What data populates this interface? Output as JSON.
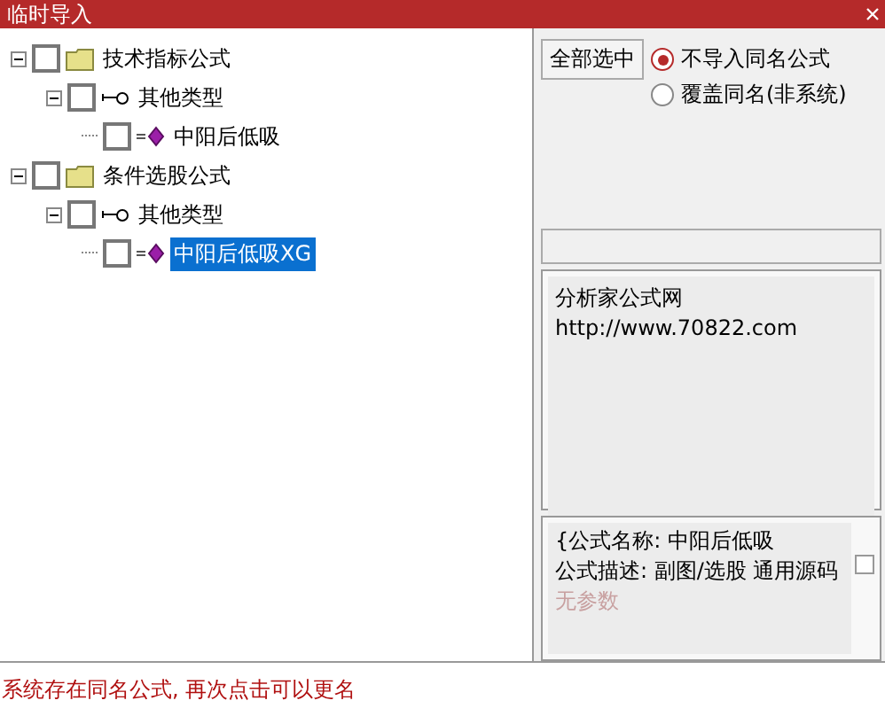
{
  "window": {
    "title": "临时导入"
  },
  "tree": [
    {
      "label": "技术指标公式",
      "kind": "folder",
      "checked": false,
      "expanded": true,
      "selected": false,
      "children": [
        {
          "label": "其他类型",
          "kind": "type",
          "checked": false,
          "expanded": true,
          "selected": false,
          "children": [
            {
              "label": "中阳后低吸",
              "kind": "formula",
              "checked": false,
              "selected": false
            }
          ]
        }
      ]
    },
    {
      "label": "条件选股公式",
      "kind": "folder",
      "checked": false,
      "expanded": true,
      "selected": false,
      "children": [
        {
          "label": "其他类型",
          "kind": "type",
          "checked": false,
          "expanded": true,
          "selected": false,
          "children": [
            {
              "label": "中阳后低吸XG",
              "kind": "formula",
              "checked": false,
              "selected": true
            }
          ]
        }
      ]
    }
  ],
  "select_all_button": "全部选中",
  "options": [
    {
      "label": "不导入同名公式",
      "selected": true
    },
    {
      "label": "覆盖同名(非系统)",
      "selected": false
    }
  ],
  "source_lines": [
    "分析家公式网",
    "http://www.70822.com"
  ],
  "description_lines": [
    "{公式名称: 中阳后低吸",
    "公式描述: 副图/选股 通用源码",
    "无参数"
  ],
  "status": "系统存在同名公式, 再次点击可以更名"
}
